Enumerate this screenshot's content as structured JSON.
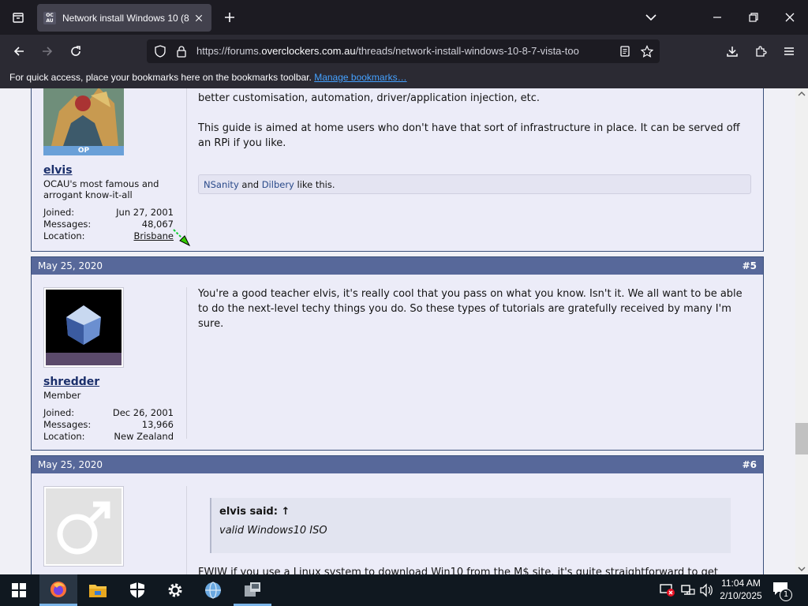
{
  "browser": {
    "tab_title": "Network install Windows 10 (8/",
    "tab_favicon_text": "OC AU",
    "url_prefix": "https://forums.",
    "url_domain": "overclockers.com.au",
    "url_path": "/threads/network-install-windows-10-8-7-vista-too",
    "bookmarks_hint": "For quick access, place your bookmarks here on the bookmarks toolbar.",
    "bookmarks_link": "Manage bookmarks…"
  },
  "posts": [
    {
      "message_lines": [
        "better customisation, automation, driver/application injection, etc.",
        "This guide is aimed at home users who don't have that sort of infrastructure in place. It can be served off an RPi if you like."
      ],
      "likes": {
        "user1": "NSanity",
        "sep": "and",
        "user2": "Dilbery",
        "suffix": "like this."
      },
      "op_badge": "OP",
      "username": "elvis",
      "usertitle": "OCAU's most famous and arrogant know-it-all",
      "stats": [
        {
          "label": "Joined:",
          "value": "Jun 27, 2001"
        },
        {
          "label": "Messages:",
          "value": "48,067"
        },
        {
          "label": "Location:",
          "value": "Brisbane"
        }
      ]
    },
    {
      "date": "May 25, 2020",
      "number": "#5",
      "username": "shredder",
      "usertitle": "Member",
      "stats": [
        {
          "label": "Joined:",
          "value": "Dec 26, 2001"
        },
        {
          "label": "Messages:",
          "value": "13,966"
        },
        {
          "label": "Location:",
          "value": "New Zealand"
        }
      ],
      "message": "You're a good teacher elvis, it's really cool that you pass on what you know. Isn't it. We all want to be able to do the next-level techy things you do. So these types of tutorials are gratefully received by many I'm sure."
    },
    {
      "date": "May 25, 2020",
      "number": "#6",
      "quote_author": "elvis said: ↑",
      "quote_text": "valid Windows10 ISO",
      "message_partial": "FWIW if you use a Linux system to download Win10 from the M$ site, it's quite straightforward to get"
    }
  ],
  "taskbar": {
    "time": "11:04 AM",
    "date": "2/10/2025",
    "notification_count": "1"
  },
  "colors": {
    "post_header": "#57689a",
    "post_bg": "#ececf8",
    "link": "#1b2f6b"
  }
}
